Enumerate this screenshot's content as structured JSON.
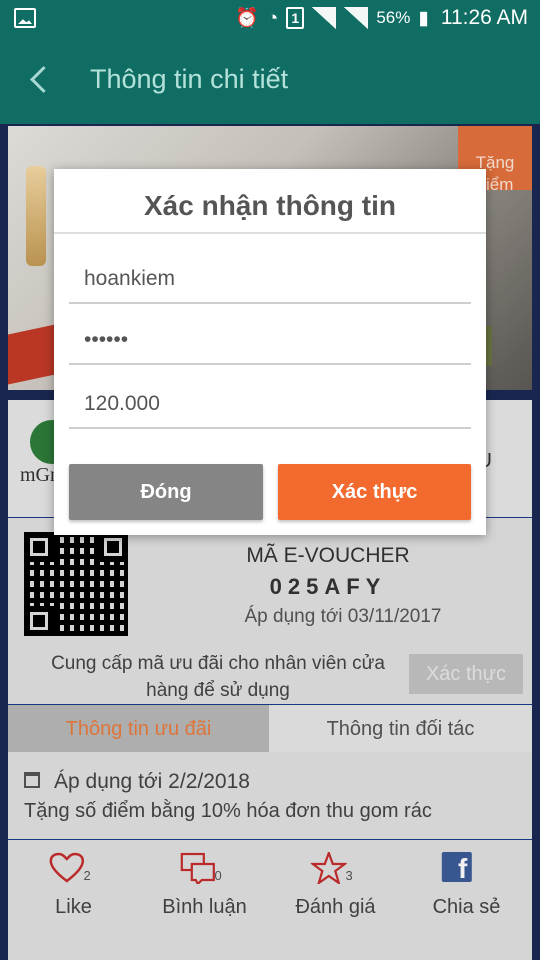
{
  "status_bar": {
    "battery": "56%",
    "time": "11:26 AM",
    "sim_slot": "1"
  },
  "app_bar": {
    "title": "Thông tin chi tiết"
  },
  "hero": {
    "tag": "Tặng điểm"
  },
  "partner": {
    "logo_text": "mGr",
    "right_mark": "U"
  },
  "voucher": {
    "title": "MÃ E-VOUCHER",
    "code": "025AFY",
    "valid_until": "Áp dụng tới 03/11/2017",
    "note": "Cung cấp mã ưu đãi cho nhân viên cửa hàng để sử dụng",
    "confirm_label": "Xác thực"
  },
  "tabs": [
    {
      "label": "Thông tin ưu đãi",
      "active": true
    },
    {
      "label": "Thông tin đối tác",
      "active": false
    }
  ],
  "offer": {
    "valid_until": "Áp dụng tới 2/2/2018",
    "description": "Tặng số điểm bằng 10% hóa đơn thu gom rác"
  },
  "actions": [
    {
      "icon": "heart-icon",
      "label": "Like",
      "count": "2"
    },
    {
      "icon": "comment-icon",
      "label": "Bình luận",
      "count": "0"
    },
    {
      "icon": "star-icon",
      "label": "Đánh giá",
      "count": "3"
    },
    {
      "icon": "facebook-icon",
      "label": "Chia sẻ",
      "count": ""
    }
  ],
  "dialog": {
    "title": "Xác nhận thông tin",
    "username": "hoankiem",
    "password": "••••••",
    "amount": "120.000",
    "close_label": "Đóng",
    "confirm_label": "Xác thực"
  },
  "colors": {
    "primary": "#0f6d63",
    "accent": "#f26a2e",
    "grey_button": "#858585",
    "facebook": "#3b5b98"
  }
}
